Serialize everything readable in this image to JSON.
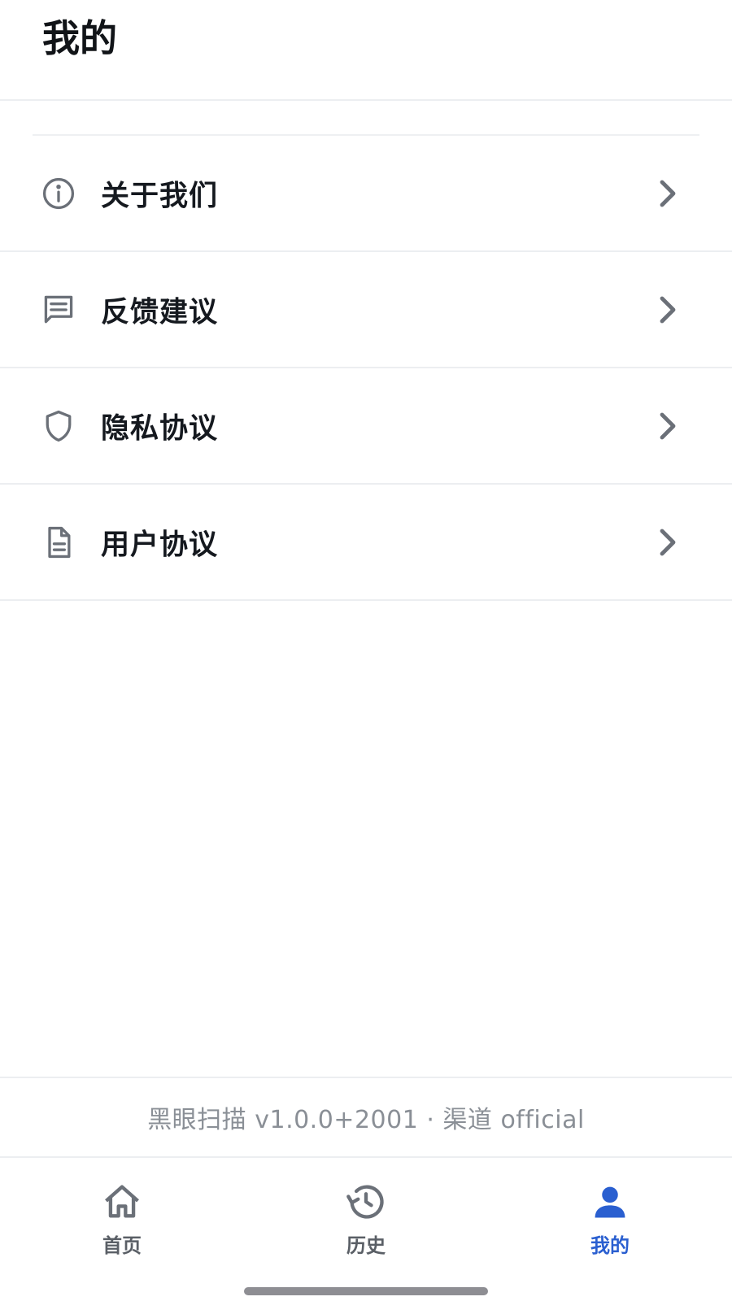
{
  "header": {
    "title": "我的"
  },
  "menu": {
    "items": [
      {
        "label": "关于我们",
        "icon": "info-icon"
      },
      {
        "label": "反馈建议",
        "icon": "message-icon"
      },
      {
        "label": "隐私协议",
        "icon": "shield-icon"
      },
      {
        "label": "用户协议",
        "icon": "document-icon"
      }
    ]
  },
  "footer": {
    "version_text": "黑眼扫描 v1.0.0+2001 · 渠道 official"
  },
  "tabbar": {
    "tabs": [
      {
        "label": "首页",
        "icon": "home-icon",
        "active": false
      },
      {
        "label": "历史",
        "icon": "history-icon",
        "active": false
      },
      {
        "label": "我的",
        "icon": "person-icon",
        "active": true
      }
    ]
  },
  "colors": {
    "accent": "#2a5fd0",
    "icon_gray": "#6b7078",
    "text_dark": "#15191f",
    "divider": "#eceef1",
    "muted_text": "#8a8f96"
  }
}
